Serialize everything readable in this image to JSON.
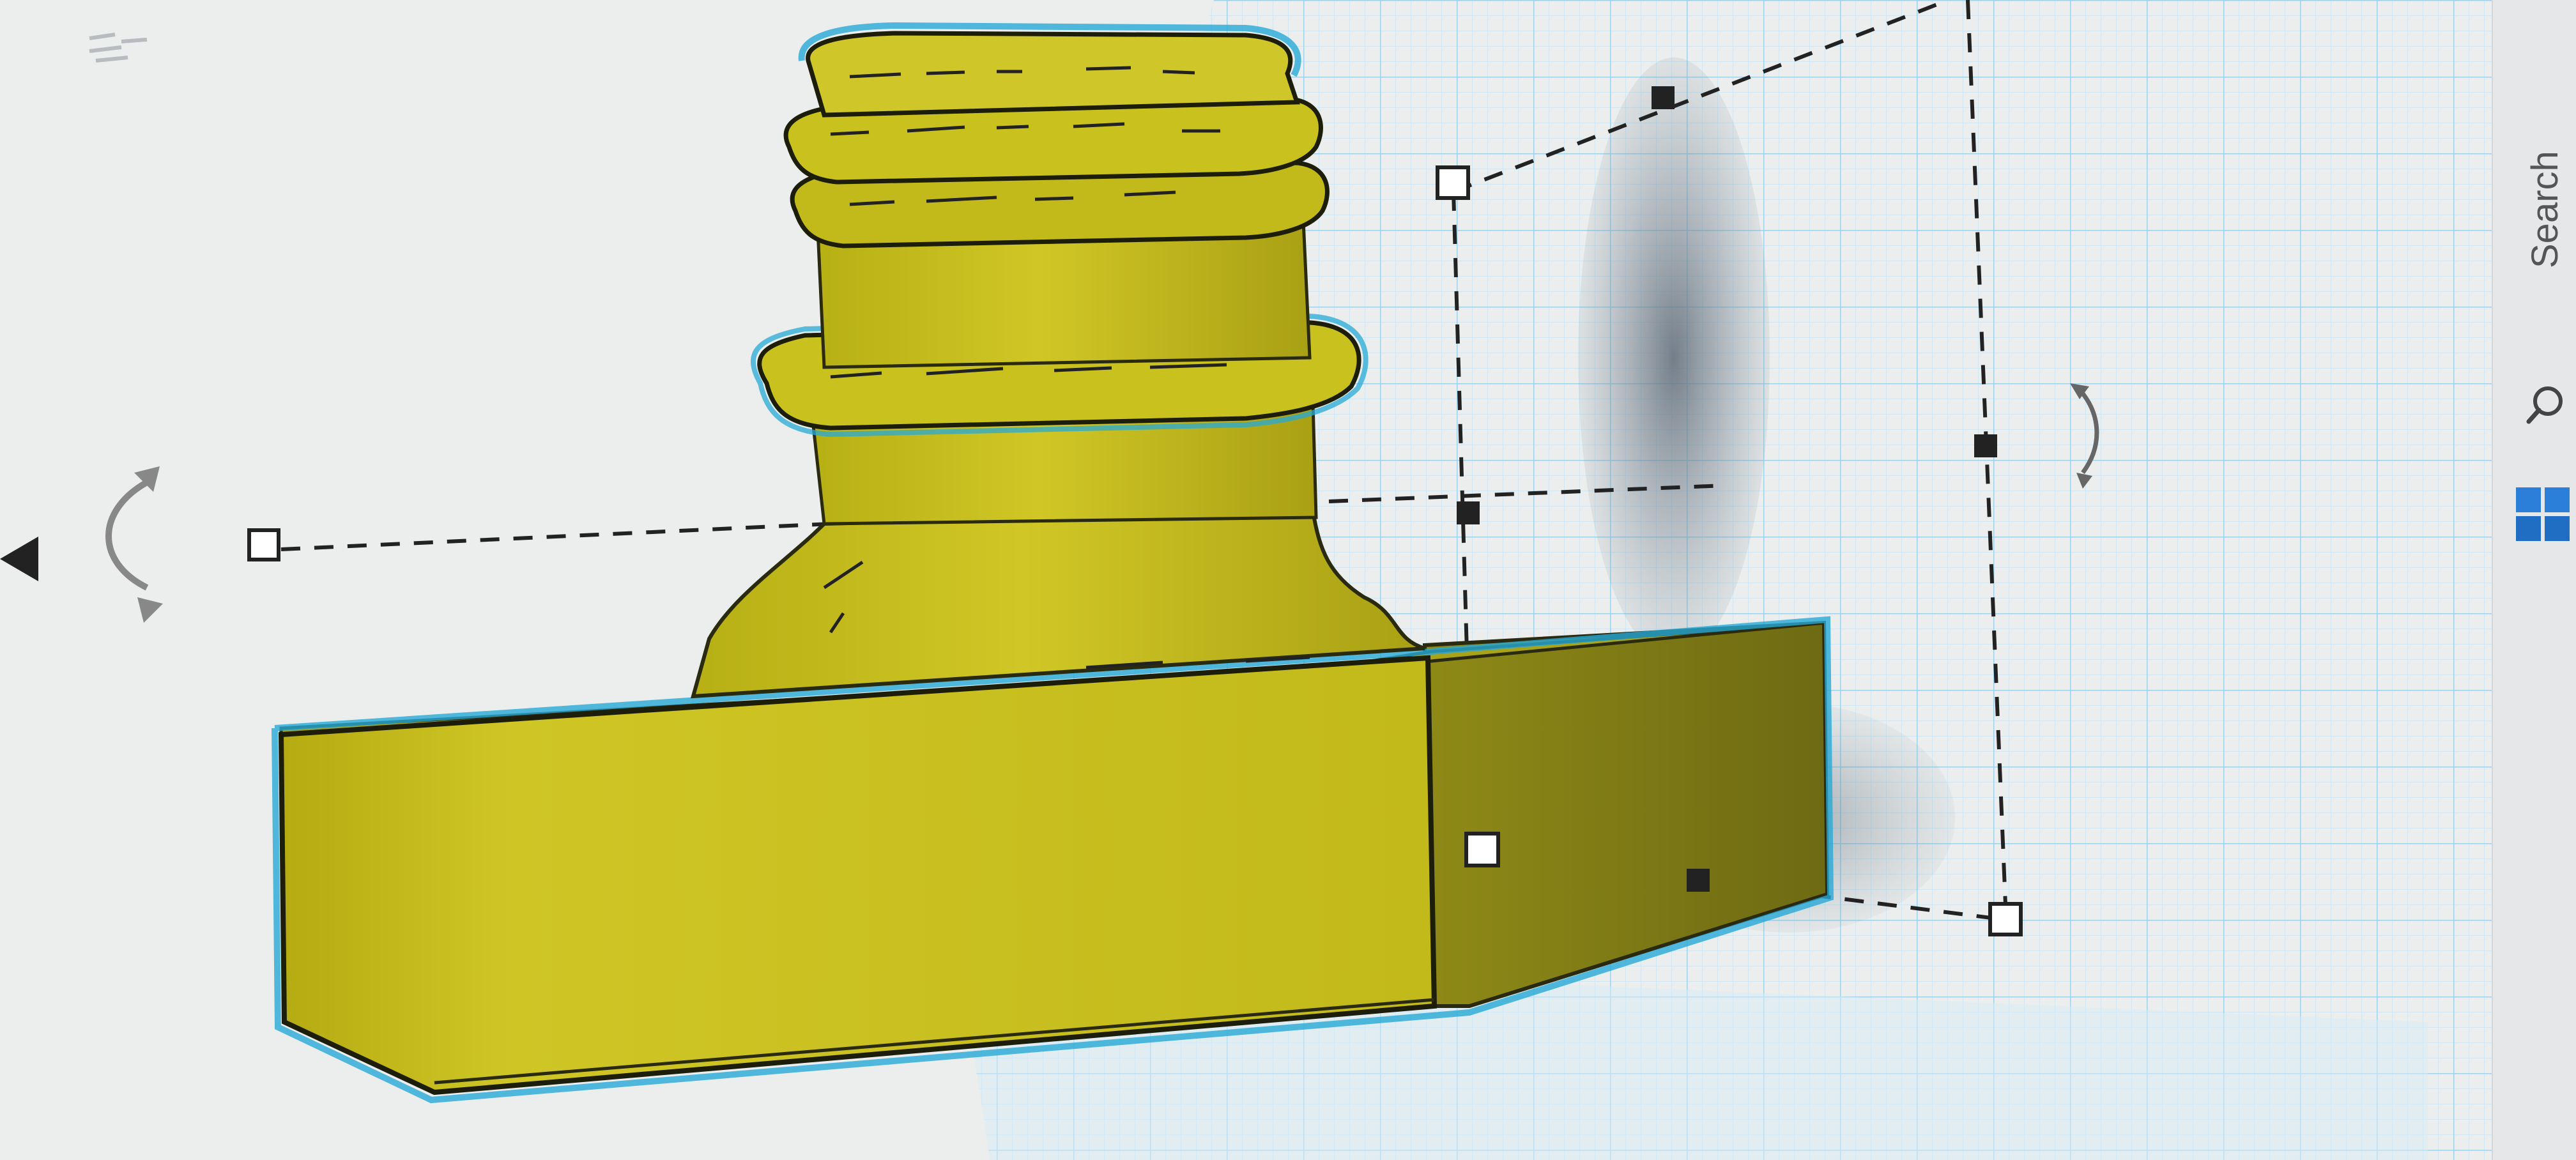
{
  "taskbar": {
    "search_label": "Search",
    "search_icon": "search-icon",
    "start_icon": "windows-start-icon"
  },
  "workplane": {
    "grid_color": "#9fd2ea",
    "grid_minor_color": "#c9e6f3",
    "background_color": "#eef6fb"
  },
  "model": {
    "color": "#c9c21e",
    "outline_color": "#27a9d6",
    "shadow_color": "#717d8a",
    "selected": true
  },
  "manipulators": {
    "rotate_left_icon": "rotate-arrow-icon",
    "rotate_right_icon": "rotate-arrow-icon",
    "move_icon": "triangle-arrow-icon"
  }
}
